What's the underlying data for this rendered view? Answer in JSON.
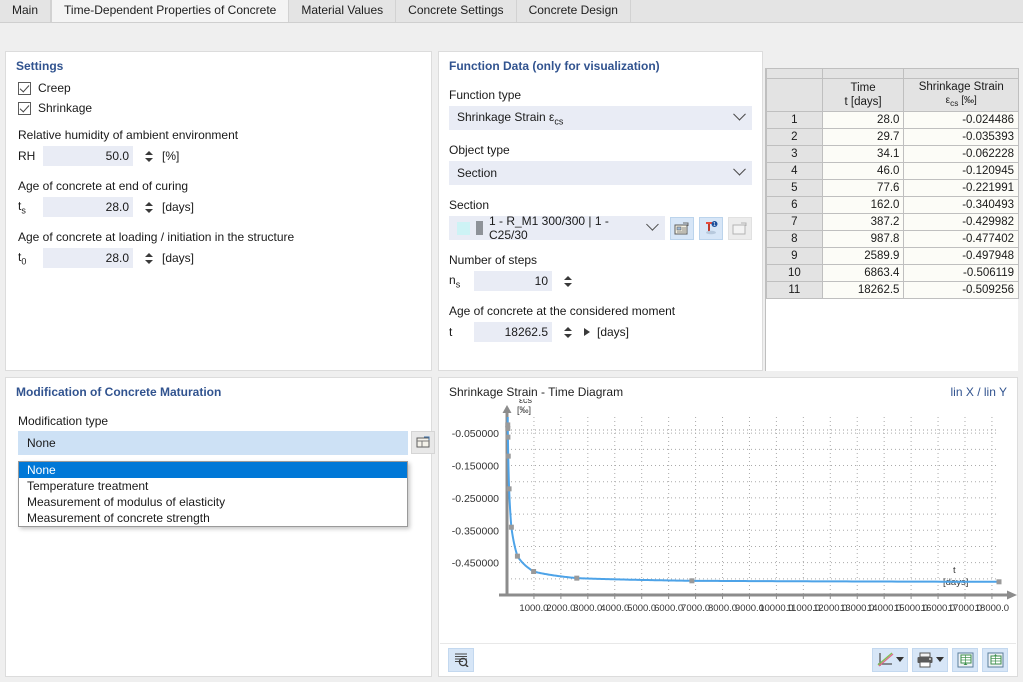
{
  "tabs": [
    {
      "label": "Main",
      "active": false
    },
    {
      "label": "Time-Dependent Properties of Concrete",
      "active": true
    },
    {
      "label": "Material Values",
      "active": false
    },
    {
      "label": "Concrete Settings",
      "active": false
    },
    {
      "label": "Concrete Design",
      "active": false
    }
  ],
  "settings": {
    "title": "Settings",
    "creep_label": "Creep",
    "creep_checked": true,
    "shrinkage_label": "Shrinkage",
    "shrinkage_checked": true,
    "rh_caption": "Relative humidity of ambient environment",
    "rh_symbol": "RH",
    "rh_value": "50.0",
    "rh_unit": "[%]",
    "ts_caption": "Age of concrete at end of curing",
    "ts_symbol": "ts",
    "ts_value": "28.0",
    "ts_unit": "[days]",
    "t0_caption": "Age of concrete at loading / initiation in the structure",
    "t0_symbol": "t0",
    "t0_value": "28.0",
    "t0_unit": "[days]"
  },
  "maturation": {
    "title": "Modification of Concrete Maturation",
    "type_label": "Modification type",
    "selected": "None",
    "options": [
      "None",
      "Temperature treatment",
      "Measurement of modulus of elasticity",
      "Measurement of concrete strength"
    ],
    "selected_index": 0
  },
  "function_data": {
    "title": "Function Data (only for visualization)",
    "function_type_label": "Function type",
    "function_type_value": "Shrinkage Strain εcs",
    "object_type_label": "Object type",
    "object_type_value": "Section",
    "section_label": "Section",
    "section_value": "1 - R_M1 300/300 | 1 - C25/30",
    "steps_label": "Number of steps",
    "steps_symbol": "ns",
    "steps_value": "10",
    "moment_label": "Age of concrete at the considered moment",
    "moment_symbol": "t",
    "moment_value": "18262.5",
    "moment_unit": "[days]"
  },
  "table": {
    "headers": [
      {
        "line1": "",
        "line2": ""
      },
      {
        "line1": "Time",
        "line2": "t [days]"
      },
      {
        "line1": "Shrinkage Strain",
        "line2": "εcs [‰]"
      }
    ],
    "rows": [
      {
        "no": "1",
        "time": "28.0",
        "strain": "-0.024486"
      },
      {
        "no": "2",
        "time": "29.7",
        "strain": "-0.035393"
      },
      {
        "no": "3",
        "time": "34.1",
        "strain": "-0.062228"
      },
      {
        "no": "4",
        "time": "46.0",
        "strain": "-0.120945"
      },
      {
        "no": "5",
        "time": "77.6",
        "strain": "-0.221991"
      },
      {
        "no": "6",
        "time": "162.0",
        "strain": "-0.340493"
      },
      {
        "no": "7",
        "time": "387.2",
        "strain": "-0.429982"
      },
      {
        "no": "8",
        "time": "987.8",
        "strain": "-0.477402"
      },
      {
        "no": "9",
        "time": "2589.9",
        "strain": "-0.497948"
      },
      {
        "no": "10",
        "time": "6863.4",
        "strain": "-0.506119"
      },
      {
        "no": "11",
        "time": "18262.5",
        "strain": "-0.509256"
      }
    ]
  },
  "chart": {
    "title": "Shrinkage Strain - Time Diagram",
    "scale_mode": "lin X / lin Y"
  },
  "chart_data": {
    "type": "line",
    "title": "Shrinkage Strain - Time Diagram",
    "xlabel": "t",
    "xunit": "[days]",
    "ylabel": "εcs",
    "yunit": "[‰]",
    "xlim": [
      0,
      18262.5
    ],
    "ylim": [
      -0.55,
      0
    ],
    "grid": true,
    "legend": "none",
    "xticks": [
      "1000.0",
      "2000.0",
      "3000.0",
      "4000.0",
      "5000.0",
      "6000.0",
      "7000.0",
      "8000.0",
      "9000.0",
      "10000.0",
      "11000.0",
      "12000.0",
      "13000.0",
      "14000.0",
      "15000.0",
      "16000.0",
      "17000.0",
      "18000.0"
    ],
    "yticks": [
      "-0.450000",
      "-0.350000",
      "-0.250000",
      "-0.150000",
      "-0.050000"
    ],
    "series": [
      {
        "name": "Shrinkage Strain",
        "color": "#4da3e8",
        "x": [
          28.0,
          29.7,
          34.1,
          46.0,
          77.6,
          162.0,
          387.2,
          987.8,
          2589.9,
          6863.4,
          18262.5
        ],
        "y": [
          -0.024486,
          -0.035393,
          -0.062228,
          -0.120945,
          -0.221991,
          -0.340493,
          -0.429982,
          -0.477402,
          -0.497948,
          -0.506119,
          -0.509256
        ]
      }
    ]
  },
  "chart_toolbar": {
    "results_table_icon": "results-table-icon",
    "curve_style_icon": "curve-style-icon",
    "print_icon": "printer-icon",
    "export_icon": "export-table-icon",
    "import_icon": "import-table-icon"
  }
}
